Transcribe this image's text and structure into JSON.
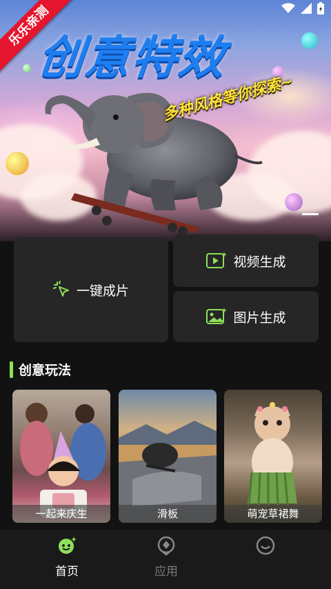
{
  "ribbon": "乐乐亲测",
  "hero": {
    "title": "创意特效",
    "subtitle": "多种风格等你探索~"
  },
  "actions": {
    "one_click": "一键成片",
    "video_gen": "视频生成",
    "image_gen": "图片生成"
  },
  "section": {
    "title": "创意玩法",
    "items": [
      {
        "caption": "一起来庆生"
      },
      {
        "caption": "滑板"
      },
      {
        "caption": "萌宠草裙舞"
      }
    ]
  },
  "nav": {
    "items": [
      {
        "label": "首页",
        "active": true,
        "icon": "smile-face-icon"
      },
      {
        "label": "应用",
        "active": false,
        "icon": "apps-badge-icon"
      },
      {
        "label": "",
        "active": false,
        "icon": "profile-face-icon"
      }
    ]
  },
  "colors": {
    "accent": "#8ee05b",
    "background": "#121212",
    "card": "#262626",
    "ribbon": "#e5152d",
    "title_blue": "#1e7ef0",
    "subtitle_yellow": "#ffe23a"
  }
}
